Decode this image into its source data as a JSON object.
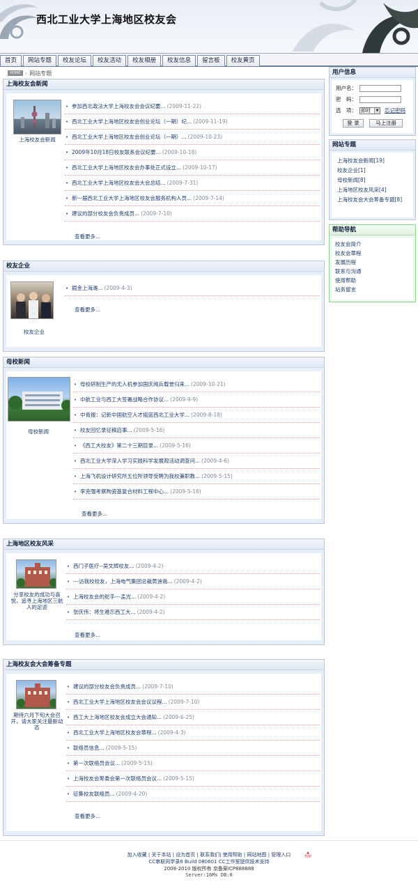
{
  "site": {
    "title": "西北工业大学上海地区校友会"
  },
  "nav": {
    "tabs": [
      "首页",
      "网站专题",
      "校友论坛",
      "校友活动",
      "校友相册",
      "校友信息",
      "留言板",
      "校友黄页"
    ]
  },
  "breadcrumb": {
    "home": "HOME",
    "current": "网站专题"
  },
  "sections": {
    "news": {
      "title": "上海校友会新闻",
      "caption": "上海校友会新闻",
      "items": [
        {
          "t": "参加西北政法大学上海校友会会议纪要...",
          "d": "(2009-11-22)"
        },
        {
          "t": "西北工业大学上海地区校友会创业论坛（一期）纪...",
          "d": "(2009-11-19)"
        },
        {
          "t": "西北工业大学上海地区校友会创业论坛（一期）...",
          "d": "(2009-10-23)"
        },
        {
          "t": "2009年10月18日校友联系会议纪要...",
          "d": "(2009-10-18)"
        },
        {
          "t": "西北工业大学上海地区校友会办事处正式设立...",
          "d": "(2009-10-17)"
        },
        {
          "t": "西北工业大学上海地区校友会大会总结...",
          "d": "(2009-7-31)"
        },
        {
          "t": "新一届西北工业大学上海地区校友会服务机构人员...",
          "d": "(2009-7-14)"
        },
        {
          "t": "建议的部分校友会负责成员...",
          "d": "(2009-7-10)"
        }
      ],
      "more": "查看更多..."
    },
    "enterprise": {
      "title": "校友企业",
      "caption": "校友企业",
      "items": [
        {
          "t": "掘金上海滩...",
          "d": "(2009-4-3)"
        }
      ],
      "more": "查看更多..."
    },
    "school": {
      "title": "母校新闻",
      "caption": "母校新闻",
      "items": [
        {
          "t": "母校研制生产的无人机参加国庆阅兵载誉归来...",
          "d": "(2009-10-21)"
        },
        {
          "t": "中航工业与西工大签署战略合作协议...",
          "d": "(2009-9-9)"
        },
        {
          "t": "中青报：记新中国航空人才摇篮西北工业大学...",
          "d": "(2009-8-18)"
        },
        {
          "t": "校友回忆录征稿启事...",
          "d": "(2009-5-16)"
        },
        {
          "t": "《西工大校友》第二十三期目录...",
          "d": "(2009-5-16)"
        },
        {
          "t": "西北工业大学深入学习实践科学发展观活动调查问...",
          "d": "(2009-4-6)"
        },
        {
          "t": "上海飞机设计研究所五位所领导受聘为我校兼职教...",
          "d": "(2009-5-15)"
        },
        {
          "t": "李克强考察陶瓷基复合材料工程中心...",
          "d": "(2009-5-16)"
        }
      ],
      "more": "查看更多..."
    },
    "style": {
      "title": "上海地区校友风采",
      "caption": "分享校友的成功与喜悦，追寻上海地区三航人的足迹",
      "items": [
        {
          "t": "西门子医疗--吴文辉校友...",
          "d": "(2009-4-2)"
        },
        {
          "t": "---访我校校友，上海电气集团总裁黄迪南...",
          "d": "(2009-4-2)"
        },
        {
          "t": "上海校友会的舵手---孟光...",
          "d": "(2009-4-2)"
        },
        {
          "t": "张庆伟：将生难忘西工大...",
          "d": "(2009-4-2)"
        }
      ],
      "more": "查看更多..."
    },
    "congress": {
      "title": "上海校友会大会筹备专题",
      "caption": "期待六月下旬大会召开，请大家关注最新动态",
      "items": [
        {
          "t": "建议的部分校友会负责成员...",
          "d": "(2009-7-10)"
        },
        {
          "t": "西北工业大学上海地区校友会会议议程...",
          "d": "(2009-7-10)"
        },
        {
          "t": "西工大上海地区校友会成立大会通知...",
          "d": "(2009-6-25)"
        },
        {
          "t": "西北工业大学上海地区校友会章程...",
          "d": "(2009-4-3)"
        },
        {
          "t": "联络员信息...",
          "d": "(2009-5-15)"
        },
        {
          "t": "第一次联络员会议...",
          "d": "(2009-5-15)"
        },
        {
          "t": "上海校友会筹委会第一次联络员会议...",
          "d": "(2009-5-15)"
        },
        {
          "t": "征集校友联络员...",
          "d": "(2009-4-20)"
        }
      ],
      "more": "查看更多..."
    }
  },
  "sidebar": {
    "user": {
      "title": "用户信息",
      "username_label": "用户名：",
      "password_label": "密　码：",
      "option_label": "选　项：",
      "option_value": "即时",
      "forgot": "忘记密码",
      "login": "登 录",
      "register": "马上注册"
    },
    "topics": {
      "title": "网站专题",
      "items": [
        "上海校友会新闻[19]",
        "校友企业[1]",
        "母校新闻[8]",
        "上海地区校友风采[4]",
        "上海校友会大会筹备专题[8]"
      ]
    },
    "help": {
      "title": "帮助导航",
      "items": [
        "校友会简介",
        "校友会章程",
        "发展历程",
        "联系与沟通",
        "使用帮助",
        "站务留言"
      ]
    }
  },
  "footer": {
    "links": "加入收藏 | 关于本站 | 设为首页 | 联系我们| 使用帮助 | 网站地图 | 管理入口",
    "top": "TOP",
    "line2": "CC串联同学录8 Build 080601 CC工作室提供技术支持",
    "line3": "2008-2010 版权所有 京备案ICP888888",
    "line4": "Server:16Ms  DB:0"
  },
  "colors": {
    "accent": "#1f3d6e",
    "panel_bg": "#e6eef7",
    "help_border": "#8fd18f",
    "dotted": "#e3a2a2"
  }
}
